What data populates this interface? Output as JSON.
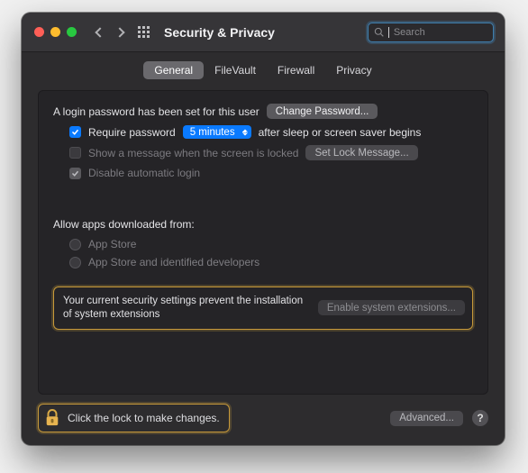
{
  "window": {
    "title": "Security & Privacy"
  },
  "search": {
    "placeholder": "Search",
    "value": ""
  },
  "tabs": {
    "general": "General",
    "filevault": "FileVault",
    "firewall": "Firewall",
    "privacy": "Privacy",
    "active": "general"
  },
  "general": {
    "login_password_set_text": "A login password has been set for this user",
    "change_password_btn": "Change Password...",
    "require_password_checked": true,
    "require_password_label_pre": "Require password",
    "require_password_delay": "5 minutes",
    "require_password_label_post": "after sleep or screen saver begins",
    "show_message_checked": false,
    "show_message_label": "Show a message when the screen is locked",
    "set_lock_message_btn": "Set Lock Message...",
    "disable_auto_login_checked": true,
    "disable_auto_login_label": "Disable automatic login"
  },
  "download": {
    "header": "Allow apps downloaded from:",
    "option_appstore": "App Store",
    "option_identified": "App Store and identified developers"
  },
  "extensions": {
    "message": "Your current security settings prevent the installation of system extensions",
    "button": "Enable system extensions..."
  },
  "footer": {
    "lock_label": "Click the lock to make changes.",
    "advanced_btn": "Advanced...",
    "help": "?"
  }
}
